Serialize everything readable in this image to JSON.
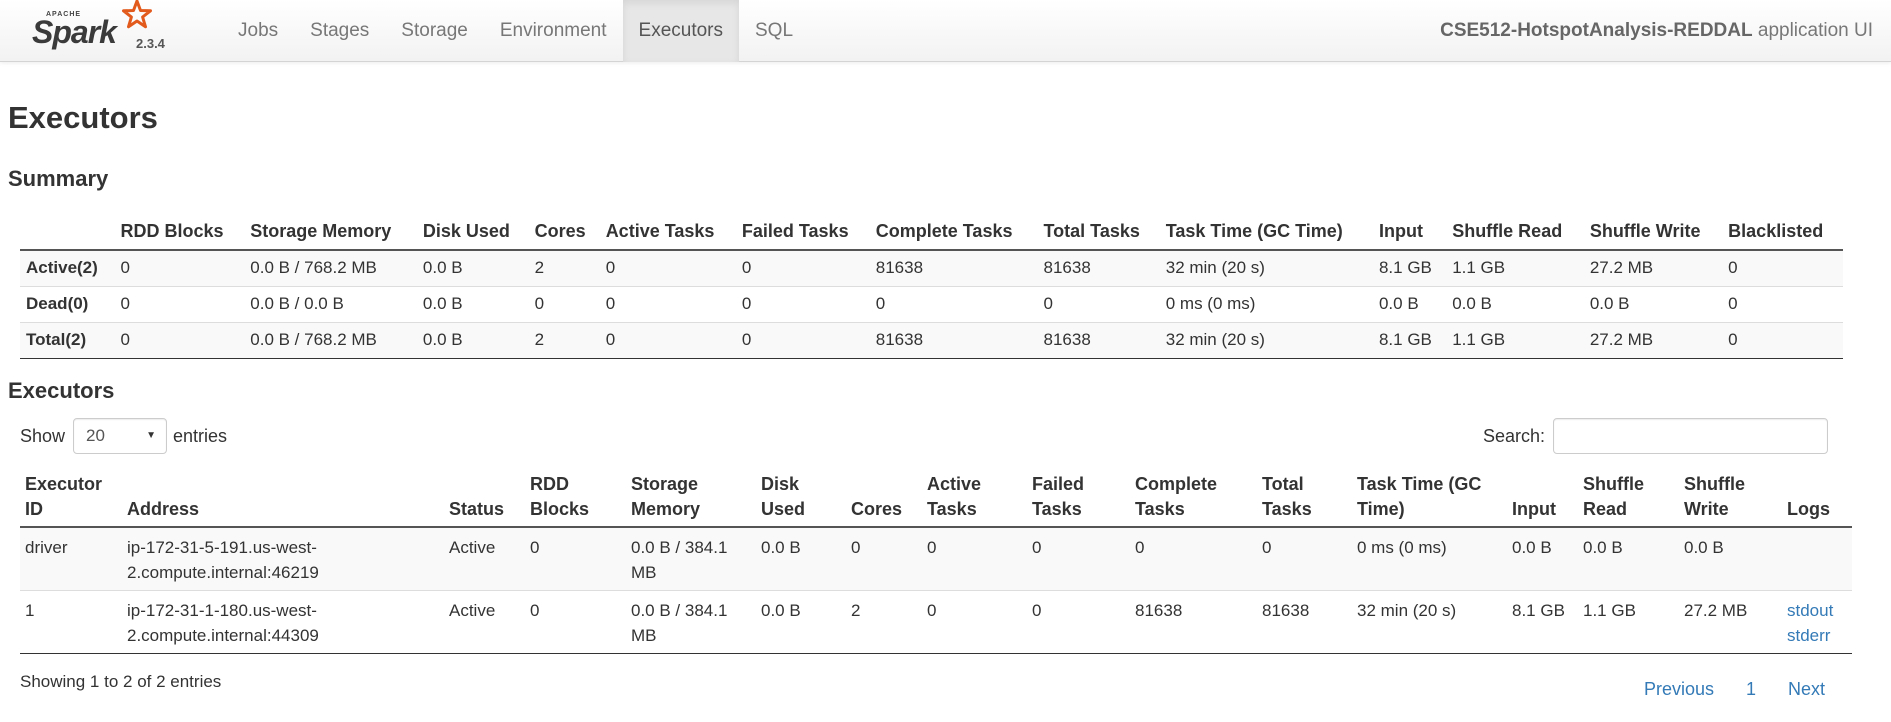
{
  "brand": {
    "apache": "APACHE",
    "name": "Spark",
    "version": "2.3.4"
  },
  "nav": {
    "tabs": [
      "Jobs",
      "Stages",
      "Storage",
      "Environment",
      "Executors",
      "SQL"
    ],
    "active": "Executors"
  },
  "app": {
    "name": "CSE512-HotspotAnalysis-REDDAL",
    "suffix": "application UI"
  },
  "page_title": "Executors",
  "summary": {
    "title": "Summary",
    "headers": [
      "",
      "RDD Blocks",
      "Storage Memory",
      "Disk Used",
      "Cores",
      "Active Tasks",
      "Failed Tasks",
      "Complete Tasks",
      "Total Tasks",
      "Task Time (GC Time)",
      "Input",
      "Shuffle Read",
      "Shuffle Write",
      "Blacklisted"
    ],
    "rows": [
      [
        "Active(2)",
        "0",
        "0.0 B / 768.2 MB",
        "0.0 B",
        "2",
        "0",
        "0",
        "81638",
        "81638",
        "32 min (20 s)",
        "8.1 GB",
        "1.1 GB",
        "27.2 MB",
        "0"
      ],
      [
        "Dead(0)",
        "0",
        "0.0 B / 0.0 B",
        "0.0 B",
        "0",
        "0",
        "0",
        "0",
        "0",
        "0 ms (0 ms)",
        "0.0 B",
        "0.0 B",
        "0.0 B",
        "0"
      ],
      [
        "Total(2)",
        "0",
        "0.0 B / 768.2 MB",
        "0.0 B",
        "2",
        "0",
        "0",
        "81638",
        "81638",
        "32 min (20 s)",
        "8.1 GB",
        "1.1 GB",
        "27.2 MB",
        "0"
      ]
    ]
  },
  "executors": {
    "title": "Executors",
    "show_label": "Show",
    "page_size": "20",
    "entries_label": "entries",
    "search_label": "Search:",
    "search_value": "",
    "headers": [
      "Executor ID",
      "Address",
      "Status",
      "RDD Blocks",
      "Storage Memory",
      "Disk Used",
      "Cores",
      "Active Tasks",
      "Failed Tasks",
      "Complete Tasks",
      "Total Tasks",
      "Task Time (GC Time)",
      "Input",
      "Shuffle Read",
      "Shuffle Write",
      "Logs"
    ],
    "rows": [
      {
        "cells": [
          "driver",
          "ip-172-31-5-191.us-west-2.compute.internal:46219",
          "Active",
          "0",
          "0.0 B / 384.1 MB",
          "0.0 B",
          "0",
          "0",
          "0",
          "0",
          "0",
          "0 ms (0 ms)",
          "0.0 B",
          "0.0 B",
          "0.0 B"
        ],
        "logs": []
      },
      {
        "cells": [
          "1",
          "ip-172-31-1-180.us-west-2.compute.internal:44309",
          "Active",
          "0",
          "0.0 B / 384.1 MB",
          "0.0 B",
          "2",
          "0",
          "0",
          "81638",
          "81638",
          "32 min (20 s)",
          "8.1 GB",
          "1.1 GB",
          "27.2 MB"
        ],
        "logs": [
          "stdout",
          "stderr"
        ]
      }
    ],
    "info": "Showing 1 to 2 of 2 entries",
    "pager": {
      "previous": "Previous",
      "page": "1",
      "next": "Next"
    }
  }
}
